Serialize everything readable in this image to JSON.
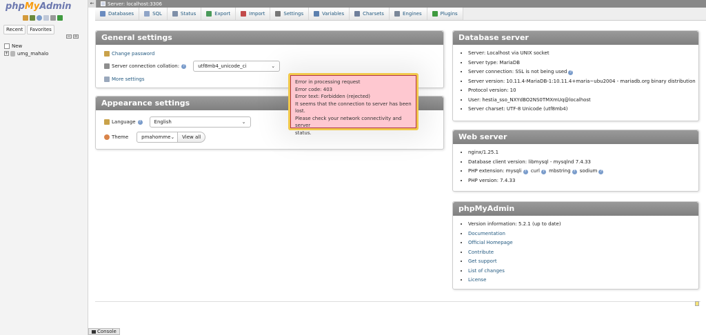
{
  "app": {
    "logo_parts": [
      "php",
      "My",
      "Admin"
    ],
    "colors": {
      "accent": "#235a81",
      "panel_header": "#888888",
      "error_bg": "#fec8d0",
      "error_border": "#f2c94c"
    }
  },
  "sidebar": {
    "tabs": [
      "Recent",
      "Favorites"
    ],
    "tree": [
      {
        "label": "New",
        "icon": "new-db-icon"
      },
      {
        "label": "umg_mahalo",
        "icon": "database-icon"
      }
    ]
  },
  "topbar": {
    "back_glyph": "←",
    "server_label": "Server: localhost:3306"
  },
  "menu": [
    {
      "name": "databases",
      "label": "Databases",
      "color": "#6a8bbf"
    },
    {
      "name": "sql",
      "label": "SQL",
      "color": "#8fa4c7"
    },
    {
      "name": "status",
      "label": "Status",
      "color": "#7e8fa8"
    },
    {
      "name": "export",
      "label": "Export",
      "color": "#4a9a5a"
    },
    {
      "name": "import",
      "label": "Import",
      "color": "#c24a4a"
    },
    {
      "name": "settings",
      "label": "Settings",
      "color": "#777777"
    },
    {
      "name": "variables",
      "label": "Variables",
      "color": "#5b7fae"
    },
    {
      "name": "charsets",
      "label": "Charsets",
      "color": "#6f7f9b"
    },
    {
      "name": "engines",
      "label": "Engines",
      "color": "#7a8799"
    },
    {
      "name": "plugins",
      "label": "Plugins",
      "color": "#3f9a3f"
    }
  ],
  "general": {
    "title": "General settings",
    "change_password": "Change password",
    "collation_label": "Server connection collation:",
    "collation_value": "utf8mb4_unicode_ci",
    "more_settings": "More settings"
  },
  "appearance": {
    "title": "Appearance settings",
    "language_label": "Language",
    "language_value": "English",
    "theme_label": "Theme",
    "theme_value": "pmahomme",
    "view_all": "View all"
  },
  "db_server": {
    "title": "Database server",
    "items": [
      "Server: Localhost via UNIX socket",
      "Server type: MariaDB",
      "Server connection: SSL is not being used",
      "Server version: 10.11.4-MariaDB-1:10.11.4+maria~ubu2004 - mariadb.org binary distribution",
      "Protocol version: 10",
      "User: hestia_sso_NXYdBO2NS0TMXmUq@localhost",
      "Server charset: UTF-8 Unicode (utf8mb4)"
    ]
  },
  "web_server": {
    "title": "Web server",
    "items": [
      "nginx/1.25.1",
      "Database client version: libmysql - mysqlnd 7.4.33"
    ],
    "php_ext_label": "PHP extension: mysqli",
    "php_ext_more": [
      "curl",
      "mbstring",
      "sodium"
    ],
    "php_version": "PHP version: 7.4.33"
  },
  "pma": {
    "title": "phpMyAdmin",
    "version": "Version information: 5.2.1 (up to date)",
    "links": [
      "Documentation",
      "Official Homepage",
      "Contribute",
      "Get support",
      "List of changes",
      "License"
    ]
  },
  "error": {
    "lines": [
      "Error in processing request",
      "Error code: 403",
      "Error text: Forbidden (rejected)",
      "It seems that the connection to server has been lost.",
      "Please check your network connectivity and server",
      "status."
    ]
  },
  "console": {
    "label": "Console"
  }
}
